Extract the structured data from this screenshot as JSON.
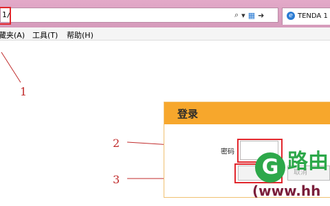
{
  "browser": {
    "address_value": "1/",
    "tab_title": "TENDA 1",
    "icons": {
      "search": "search-icon",
      "dropdown": "dropdown-icon",
      "compat": "compatibility-icon",
      "go": "go-arrow-icon",
      "tab_icon": "ie-icon"
    }
  },
  "menu": {
    "favorites": "藏夹(A)",
    "tools": "工具(T)",
    "help": "帮助(H)"
  },
  "annotations": {
    "one": "1",
    "two": "2",
    "three": "3",
    "color": "#e1262c"
  },
  "login": {
    "title": "登录",
    "password_label": "密码",
    "cancel_label": "取消",
    "header_color": "#f7a72c"
  },
  "watermark": {
    "logo_letter": "G",
    "text": "路由",
    "url": "(www.hh",
    "color": "#2da84a"
  }
}
